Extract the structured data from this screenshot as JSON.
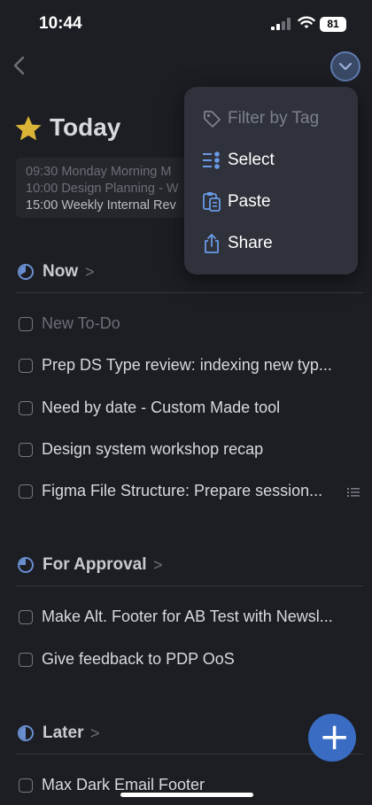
{
  "status_bar": {
    "time": "10:44",
    "battery": "81"
  },
  "header": {
    "title": "Today",
    "icons": [
      "back-chevron-icon",
      "more-circle-icon",
      "star-icon"
    ]
  },
  "calendar_events": [
    {
      "time": "09:30",
      "text": "Monday Morning M"
    },
    {
      "time": "10:00",
      "text": "Design Planning - W"
    },
    {
      "time": "15:00",
      "text": "Weekly Internal Rev"
    }
  ],
  "menu": {
    "items": [
      {
        "label": "Filter by Tag",
        "icon": "tag-icon",
        "disabled": true
      },
      {
        "label": "Select",
        "icon": "select-list-icon"
      },
      {
        "label": "Paste",
        "icon": "clipboard-icon"
      },
      {
        "label": "Share",
        "icon": "share-icon"
      }
    ]
  },
  "sections": [
    {
      "title": "Now",
      "chevron": ">",
      "tasks": [
        {
          "label": "New To-Do",
          "placeholder": true
        },
        {
          "label": "Prep DS Type review: indexing new typ..."
        },
        {
          "label": "Need by date - Custom Made tool"
        },
        {
          "label": "Design system workshop recap"
        },
        {
          "label": "Figma File Structure: Prepare session...",
          "has_notes": true
        }
      ]
    },
    {
      "title": "For Approval",
      "chevron": ">",
      "tasks": [
        {
          "label": "Make Alt. Footer for AB Test with Newsl..."
        },
        {
          "label": "Give feedback to PDP OoS"
        }
      ]
    },
    {
      "title": "Later",
      "chevron": ">",
      "tasks": [
        {
          "label": "Max Dark Email Footer"
        }
      ]
    }
  ],
  "fab": {
    "label": "+"
  },
  "colors": {
    "background": "#1c1e24",
    "accent": "#3a6cc4",
    "star": "#d9b437",
    "menu_bg": "#2f323a"
  }
}
